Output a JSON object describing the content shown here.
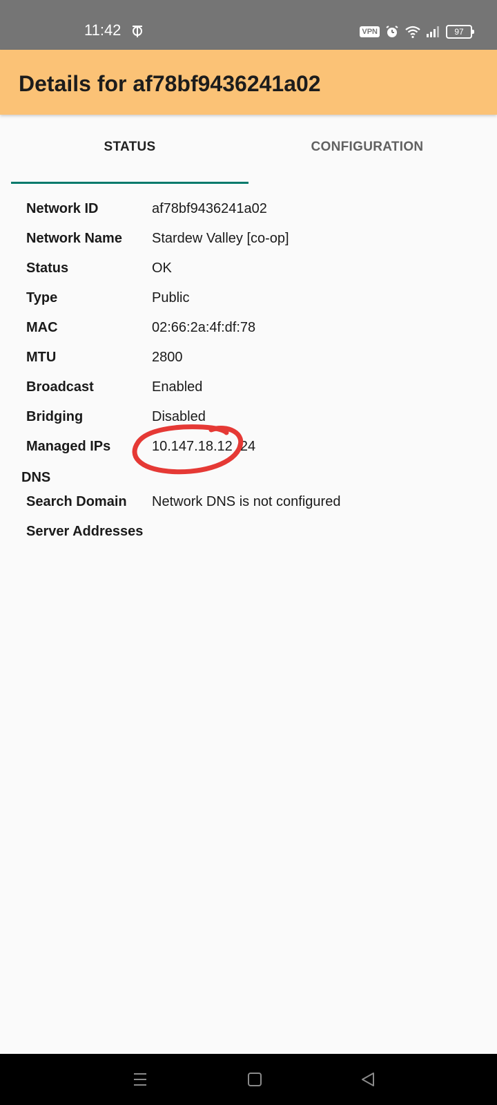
{
  "status_bar": {
    "time": "11:42",
    "vpn_label": "VPN",
    "battery_level": "97",
    "icons": [
      "app-notification-icon",
      "alarm-icon",
      "wifi-icon",
      "signal-icon",
      "battery-icon"
    ]
  },
  "app_bar": {
    "title": "Details for af78bf9436241a02",
    "background_color": "#fbc276"
  },
  "tabs": [
    {
      "label": "STATUS",
      "selected": true
    },
    {
      "label": "CONFIGURATION",
      "selected": false
    }
  ],
  "accent_color": "#00796b",
  "details": {
    "network_id": {
      "label": "Network ID",
      "value": "af78bf9436241a02"
    },
    "network_name": {
      "label": "Network Name",
      "value": "Stardew Valley [co-op]"
    },
    "status": {
      "label": "Status",
      "value": "OK"
    },
    "type": {
      "label": "Type",
      "value": "Public"
    },
    "mac": {
      "label": "MAC",
      "value": "02:66:2a:4f:df:78"
    },
    "mtu": {
      "label": "MTU",
      "value": "2800"
    },
    "broadcast": {
      "label": "Broadcast",
      "value": "Enabled"
    },
    "bridging": {
      "label": "Bridging",
      "value": "Disabled"
    },
    "managed_ips": {
      "label": "Managed IPs",
      "value": "10.147.18.12 /24"
    }
  },
  "dns": {
    "heading": "DNS",
    "search_domain": {
      "label": "Search Domain",
      "value": "Network DNS is not configured"
    },
    "server_addresses": {
      "label": "Server Addresses",
      "value": ""
    }
  },
  "annotation": {
    "type": "red-circle-highlight",
    "color": "#e53935"
  },
  "nav_bar": {
    "icons": [
      "menu-icon",
      "home-square-icon",
      "back-triangle-icon"
    ]
  }
}
